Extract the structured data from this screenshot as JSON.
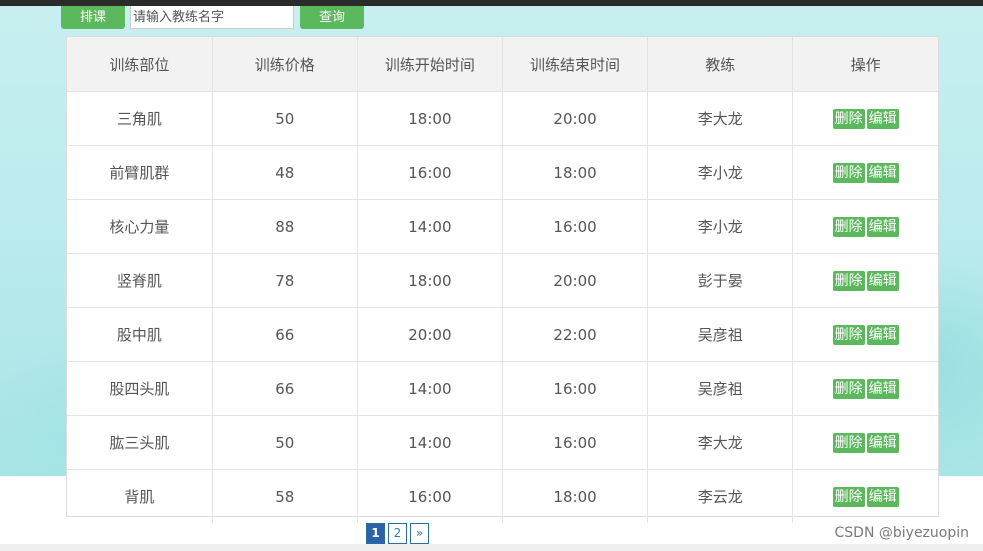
{
  "toolbar": {
    "schedule_label": "排课",
    "search_placeholder": "请输入教练名字",
    "search_value": "",
    "query_label": "查询"
  },
  "table": {
    "headers": [
      "训练部位",
      "训练价格",
      "训练开始时间",
      "训练结束时间",
      "教练",
      "操作"
    ],
    "rows": [
      {
        "part": "三角肌",
        "price": "50",
        "start": "18:00",
        "end": "20:00",
        "coach": "李大龙"
      },
      {
        "part": "前臂肌群",
        "price": "48",
        "start": "16:00",
        "end": "18:00",
        "coach": "李小龙"
      },
      {
        "part": "核心力量",
        "price": "88",
        "start": "14:00",
        "end": "16:00",
        "coach": "李小龙"
      },
      {
        "part": "竖脊肌",
        "price": "78",
        "start": "18:00",
        "end": "20:00",
        "coach": "彭于晏"
      },
      {
        "part": "股中肌",
        "price": "66",
        "start": "20:00",
        "end": "22:00",
        "coach": "吴彦祖"
      },
      {
        "part": "股四头肌",
        "price": "66",
        "start": "14:00",
        "end": "16:00",
        "coach": "吴彦祖"
      },
      {
        "part": "肱三头肌",
        "price": "50",
        "start": "14:00",
        "end": "16:00",
        "coach": "李大龙"
      },
      {
        "part": "背肌",
        "price": "58",
        "start": "16:00",
        "end": "18:00",
        "coach": "李云龙"
      }
    ],
    "delete_label": "删除",
    "edit_label": "编辑"
  },
  "pagination": {
    "pages": [
      "1",
      "2"
    ],
    "current": "1",
    "next_label": "»"
  },
  "watermark": "CSDN @biyezuopin",
  "colors": {
    "accent_green": "#5cb85c",
    "page_active": "#2a63a8",
    "background_teal": "#bdecee"
  }
}
